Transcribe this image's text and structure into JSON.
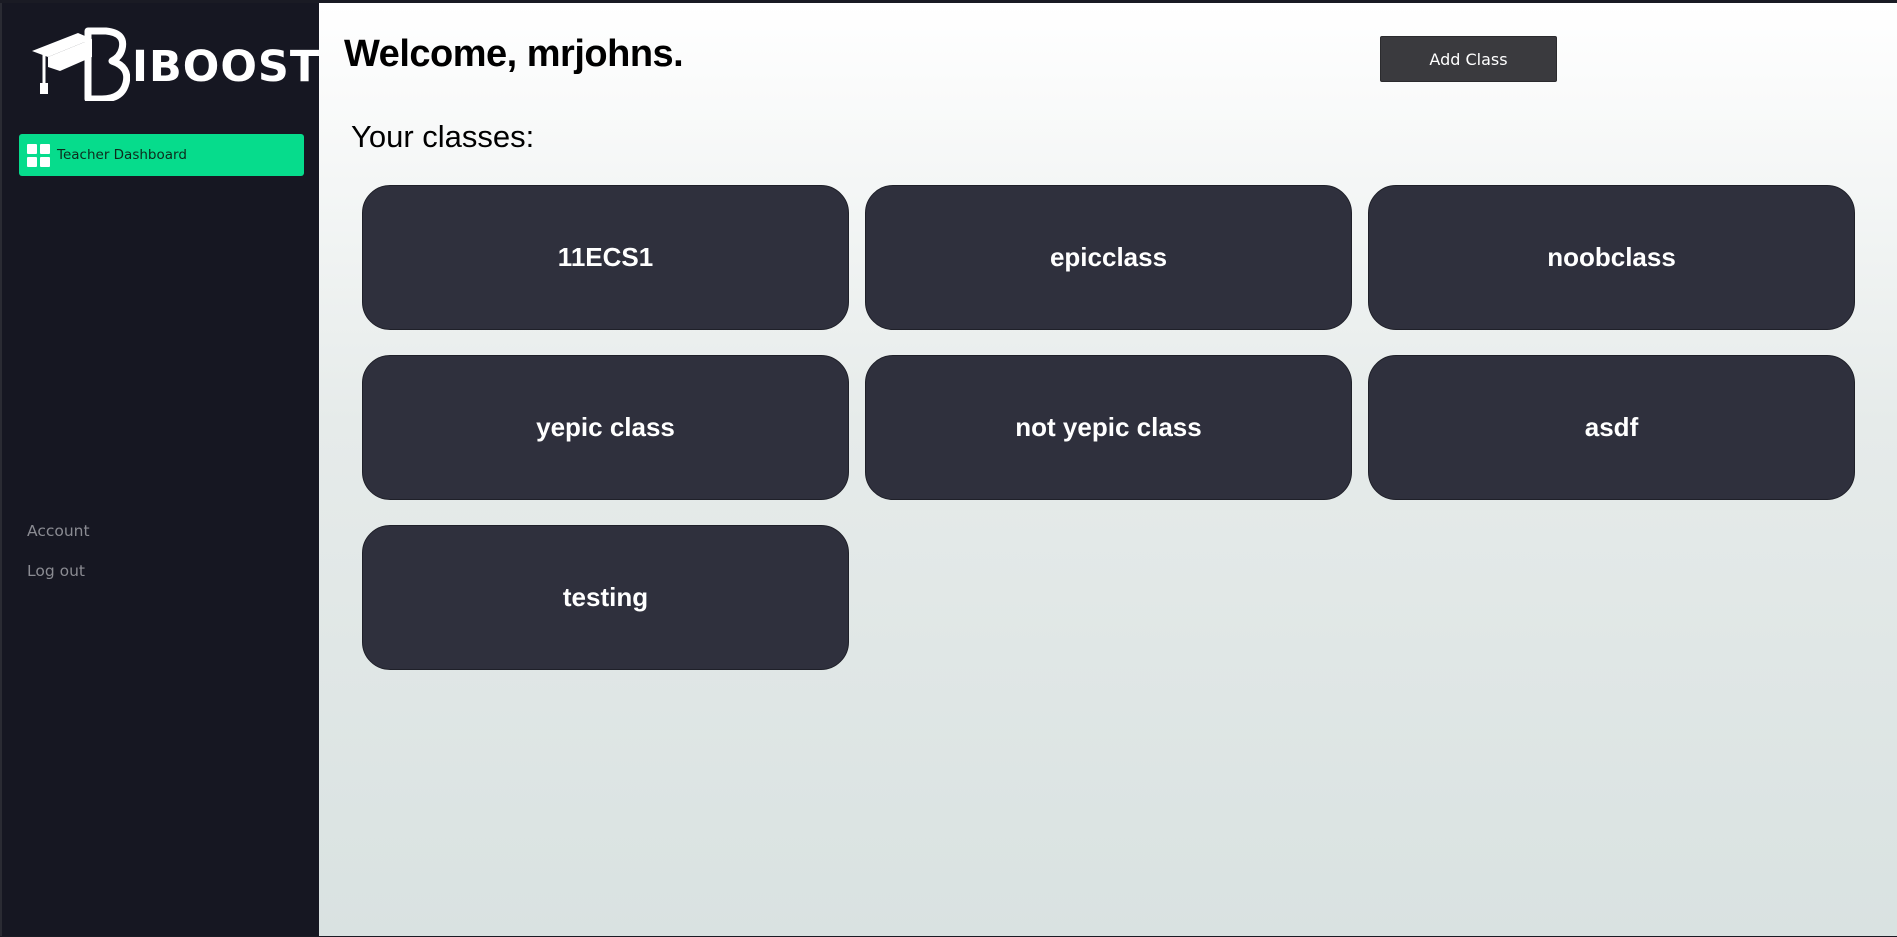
{
  "brand": {
    "name": "IBOOST"
  },
  "sidebar": {
    "active_item": {
      "label": "Teacher Dashboard",
      "icon": "grid-icon"
    },
    "account_label": "Account",
    "logout_label": "Log out"
  },
  "header": {
    "welcome_prefix": "Welcome, ",
    "username": "mrjohns",
    "welcome_suffix": ".",
    "add_class_label": "Add Class"
  },
  "main": {
    "section_title": "Your classes:",
    "classes": [
      {
        "name": "11ECS1"
      },
      {
        "name": "epicclass"
      },
      {
        "name": "noobclass"
      },
      {
        "name": "yepic class"
      },
      {
        "name": "not yepic class"
      },
      {
        "name": "asdf"
      },
      {
        "name": "testing"
      }
    ]
  },
  "colors": {
    "sidebar_bg": "#161722",
    "accent": "#06dc8c",
    "card_bg": "#2f303d",
    "button_bg": "#3a3a3e"
  }
}
